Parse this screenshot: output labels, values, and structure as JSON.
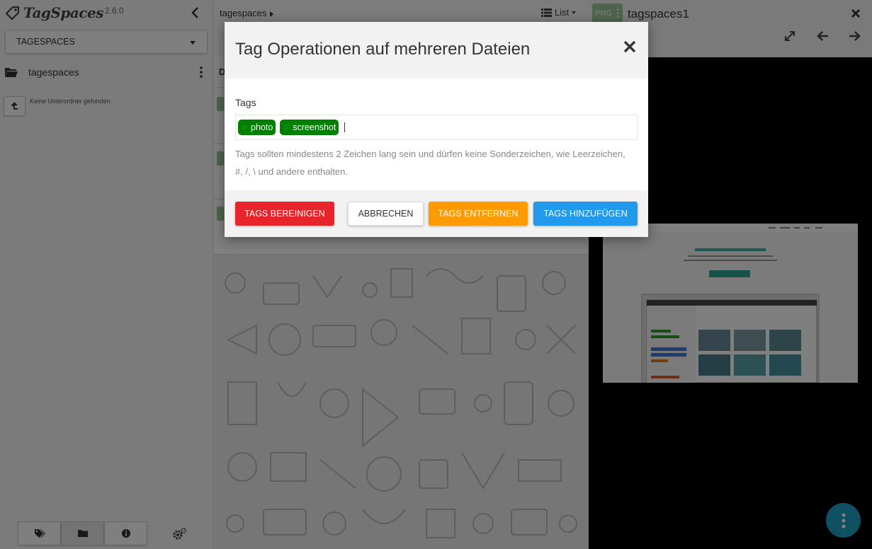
{
  "app": {
    "name": "TagSpaces",
    "version": "2.6.0"
  },
  "sidebar": {
    "location_selector": "TAGESPACES",
    "location_name": "tagespaces",
    "no_subfolders": "Keine Unterordner gefunden",
    "up_icon": "arrow-up-icon"
  },
  "middle": {
    "breadcrumb": "tagespaces",
    "view_mode": "List",
    "column_header": "D"
  },
  "preview": {
    "extension": "PNG",
    "file_title": "tagspaces1"
  },
  "modal": {
    "title": "Tag Operationen auf mehreren Dateien",
    "tags_label": "Tags",
    "tags": [
      "photo",
      "screenshot"
    ],
    "help_text": "Tags sollten mindestens 2 Zeichen lang sein und dürfen keine Sonderzeichen, wie Leerzeichen, #, /, \\ und andere enthalten.",
    "buttons": {
      "clean": "TAGS BEREINIGEN",
      "cancel": "ABBRECHEN",
      "remove": "TAGS ENTFERNEN",
      "add": "TAGS HINZUFÜGEN"
    }
  },
  "colors": {
    "tag": "#008000",
    "danger": "#e8242b",
    "warning": "#ff9a00",
    "primary": "#2199ec",
    "fab": "#1fa2c5",
    "file_ext": "#9fc99f"
  }
}
